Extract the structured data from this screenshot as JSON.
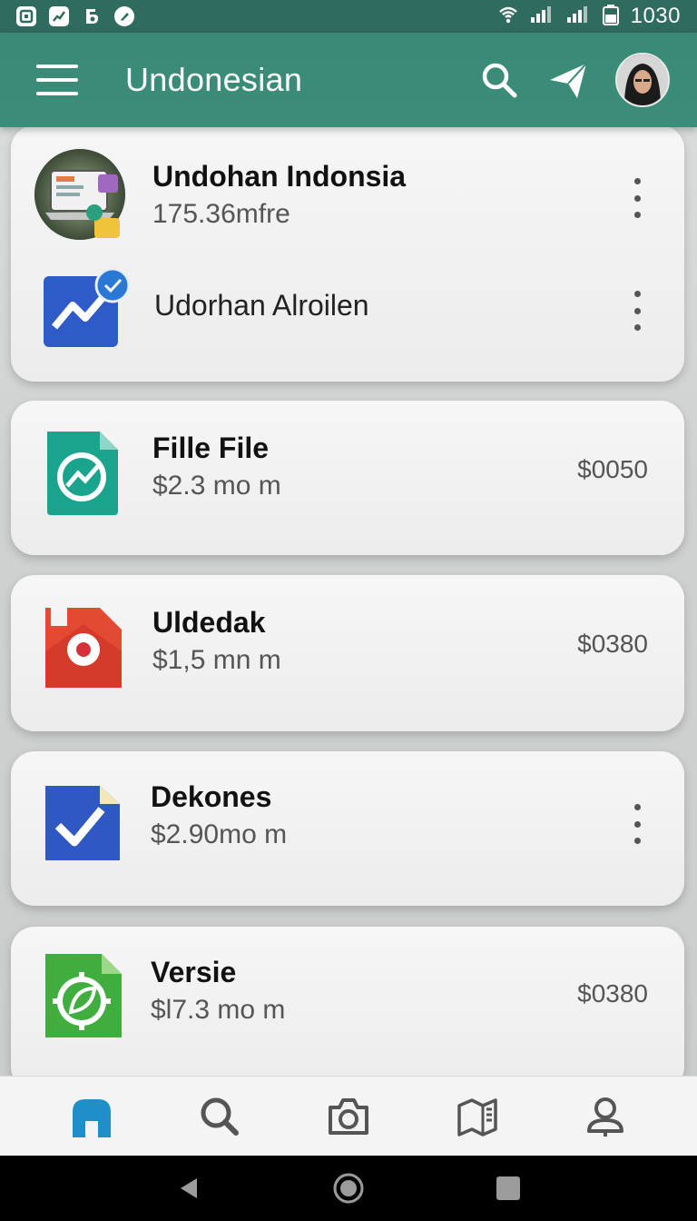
{
  "status_bar": {
    "time": "1030",
    "left_icons": [
      "notification-c-icon",
      "chart-app-icon",
      "b-app-icon",
      "pen-app-icon"
    ],
    "right_icons": [
      "wifi-icon",
      "signal-icon",
      "signal-icon",
      "battery-icon"
    ]
  },
  "app_bar": {
    "title": "Undonesian",
    "actions": [
      "search-icon",
      "send-icon",
      "avatar"
    ]
  },
  "cards": [
    {
      "rows": [
        {
          "title": "Undohan Indonsia",
          "subtitle": "175.36mfre",
          "icon": "laptop-image-icon",
          "trailing": "menu"
        },
        {
          "title": "Udorhan Alroilen",
          "icon": "chart-check-icon",
          "trailing": "menu"
        }
      ]
    },
    {
      "title": "Fille File",
      "subtitle": "$2.3 mo m",
      "price": "$0050",
      "icon": "teal-chart-doc-icon"
    },
    {
      "title": "Uldedak",
      "subtitle": "$1,5 mn m",
      "price": "$0380",
      "icon": "red-folder-icon"
    },
    {
      "title": "Dekones",
      "subtitle": "$2.90mo m",
      "trailing": "menu",
      "icon": "blue-check-doc-icon"
    },
    {
      "title": "Versie",
      "subtitle": "$l7.3 mo m",
      "price": "$0380",
      "icon": "green-gear-doc-icon"
    }
  ],
  "bottom_nav": [
    "home-icon",
    "search-icon",
    "camera-icon",
    "map-icon",
    "profile-icon"
  ],
  "colors": {
    "primary": "#3a8a78",
    "status": "#2f6b5e",
    "nav_active": "#1e8fc8"
  }
}
